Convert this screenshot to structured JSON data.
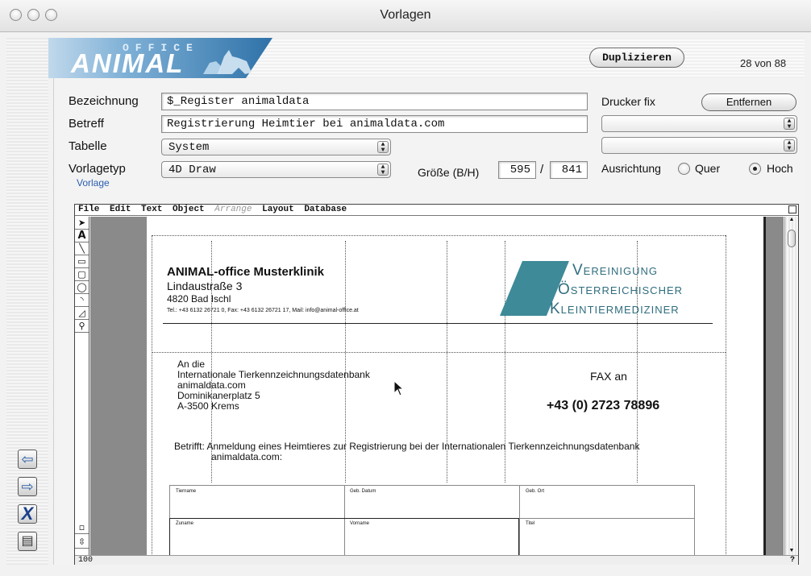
{
  "window": {
    "title": "Vorlagen"
  },
  "header": {
    "logo_main": "ANIMAL",
    "logo_small": "OFFICE",
    "duplicate_label": "Duplizieren",
    "record_counter": "28 von 88"
  },
  "form": {
    "bezeichnung_label": "Bezeichnung",
    "bezeichnung_value": "$_Register animaldata",
    "betreff_label": "Betreff",
    "betreff_value": "Registrierung Heimtier bei animaldata.com",
    "tabelle_label": "Tabelle",
    "tabelle_value": "System",
    "vorlagetyp_label": "Vorlagetyp",
    "vorlagetyp_value": "4D Draw",
    "groesse_label": "Größe (B/H)",
    "width_value": "595",
    "height_value": "841",
    "slash": "/",
    "drucker_label": "Drucker fix",
    "entfernen_label": "Entfernen",
    "ausrichtung_label": "Ausrichtung",
    "quer_label": "Quer",
    "hoch_label": "Hoch",
    "orientation_selected": "Hoch",
    "vorlage_tab": "Vorlage"
  },
  "editor": {
    "menus": [
      "File",
      "Edit",
      "Text",
      "Object",
      "Arrange",
      "Layout",
      "Database"
    ],
    "zoom": "100",
    "help": "?"
  },
  "document": {
    "clinic_name": "ANIMAL-office Musterklinik",
    "street": "Lindaustraße 3",
    "city": "4820 Bad Ischl",
    "contact": "Tel.: +43 6132 26721 0, Fax: +43 6132 26721 17, Mail: info@animal-office.at",
    "association_line1": "Vereinigung",
    "association_line2": "Österreichischer",
    "association_line3": "Kleintiermediziner",
    "recipient_1": "An die",
    "recipient_2": "Internationale Tierkennzeichnungsdatenbank",
    "recipient_3": "animaldata.com",
    "recipient_4": "Dominikanerplatz 5",
    "recipient_5": "A-3500 Krems",
    "fax_label": "FAX an",
    "fax_number": "+43 (0) 2723 78896",
    "subject_line1": "Betrifft: Anmeldung eines Heimtieres zur Registrierung bei der Internationalen Tierkennzeichnungsdatenbank",
    "subject_line2": "animaldata.com:",
    "table_cell_1": "Tiername",
    "table_cell_2": "Geb. Datum",
    "table_cell_3": "Geb. Ort",
    "table_cell_4": "Zuname",
    "table_cell_5": "Vorname",
    "table_cell_6": "Titel"
  },
  "colors": {
    "accent": "#2f72a8",
    "association": "#2f6d7e",
    "canvas": "#8a8a8a"
  }
}
